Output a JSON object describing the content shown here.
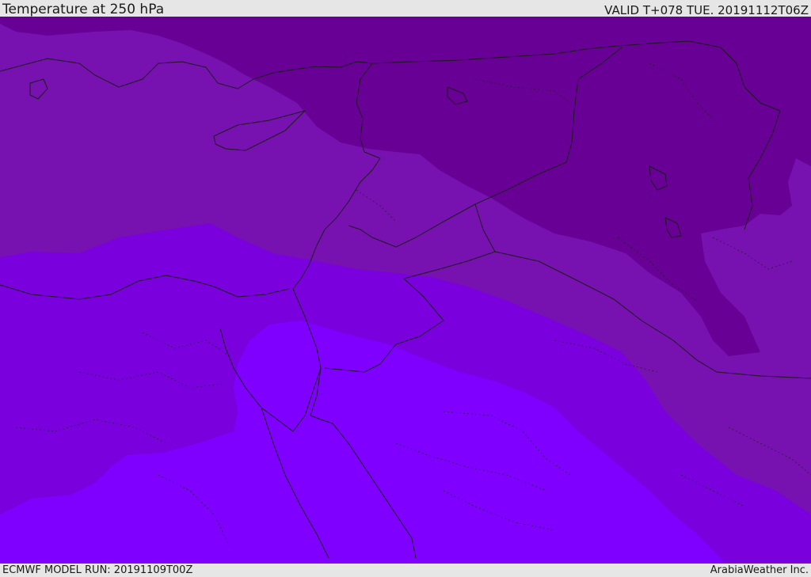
{
  "header": {
    "title": "Temperature at 250 hPa",
    "valid": "VALID T+078 TUE. 20191112T06Z"
  },
  "footer": {
    "model_run": "ECMWF MODEL RUN: 20191109T00Z",
    "credit": "ArabiaWeather Inc."
  },
  "colors": {
    "coldest": "#680095",
    "cold": "#7711b0",
    "mild": "#7a00dd",
    "warm": "#7f00ff",
    "border": "#1a1a1a"
  }
}
